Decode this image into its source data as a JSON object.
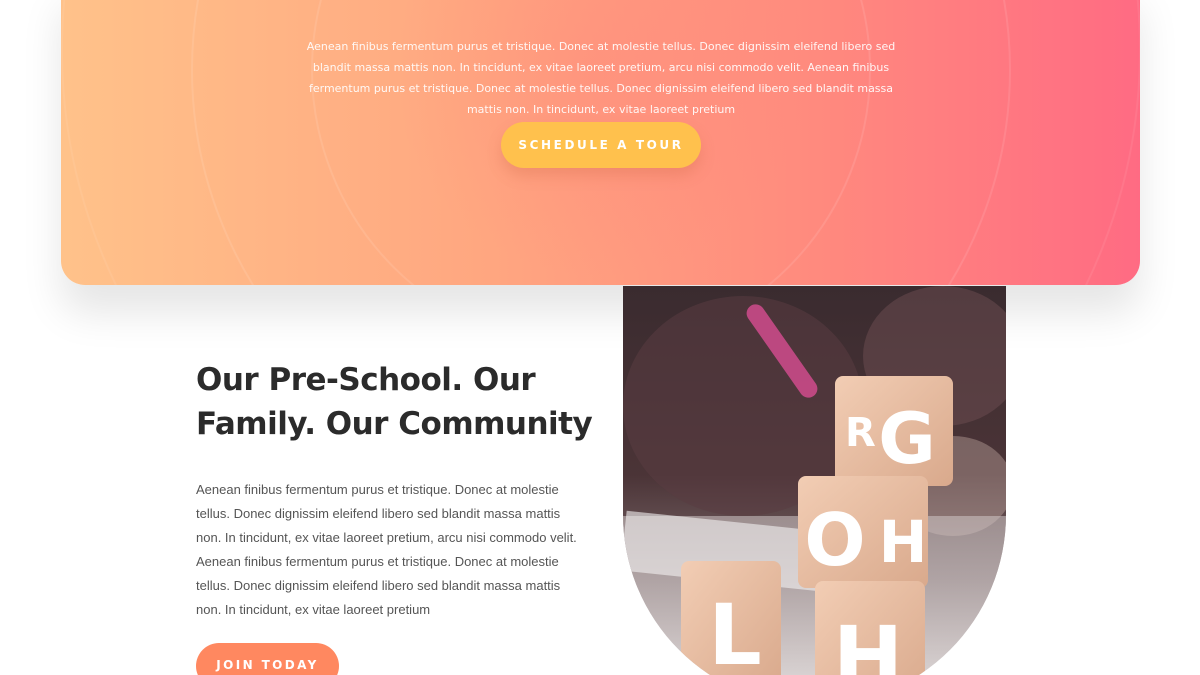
{
  "hero": {
    "paragraph": "Aenean finibus fermentum purus et tristique. Donec at molestie tellus. Donec dignissim eleifend libero sed blandit massa mattis non. In tincidunt, ex vitae laoreet pretium, arcu nisi commodo velit. Aenean finibus fermentum purus et tristique. Donec at molestie tellus. Donec dignissim eleifend libero sed blandit massa mattis non. In tincidunt, ex vitae laoreet pretium",
    "button_label": "SCHEDULE A TOUR"
  },
  "about": {
    "title": "Our Pre-School. Our Family. Our Community",
    "paragraph": "Aenean finibus fermentum purus et tristique. Donec at molestie tellus. Donec dignissim eleifend libero sed blandit massa mattis non. In tincidunt, ex vitae laoreet pretium, arcu nisi commodo velit. Aenean finibus fermentum purus et tristique. Donec at molestie tellus. Donec dignissim eleifend libero sed blandit massa mattis non. In tincidunt, ex vitae laoreet pretium",
    "button_label": "JOIN TODAY",
    "image_blocks": [
      "G",
      "R",
      "H",
      "O",
      "L",
      "H"
    ]
  },
  "colors": {
    "hero_gradient_start": "#ffc28a",
    "hero_gradient_end": "#ff6b83",
    "tour_button": "#ffc14d",
    "join_button": "#ff8860",
    "heading": "#2b2b2b",
    "body_text": "#555555"
  }
}
